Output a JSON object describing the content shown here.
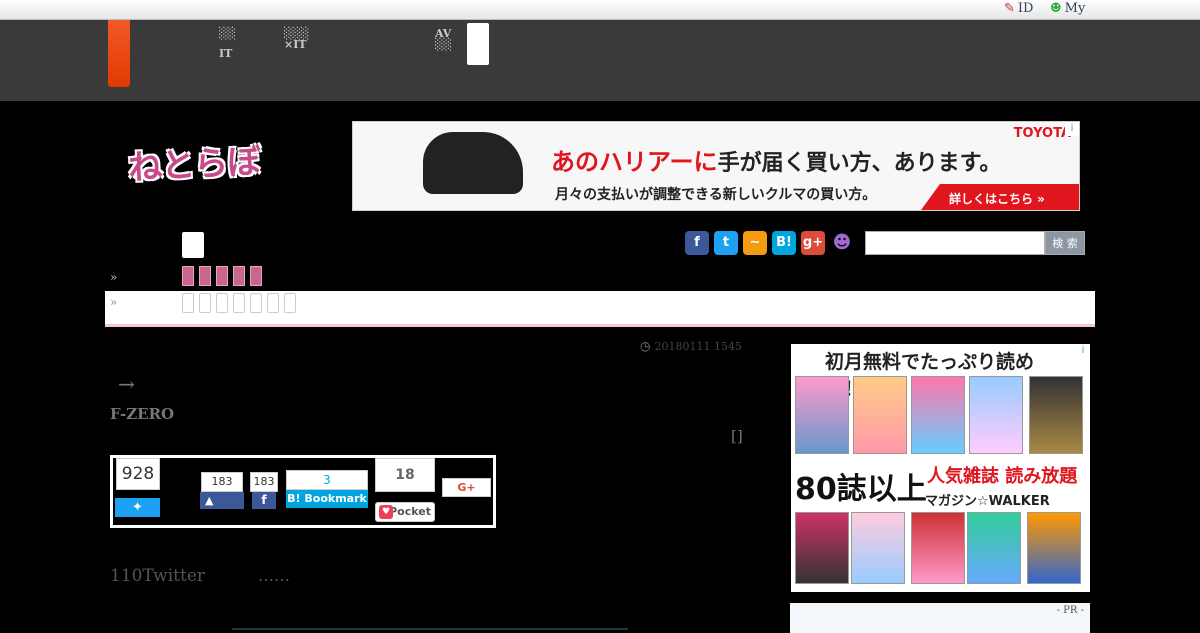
{
  "topbar": {
    "id_label": "ID",
    "my_label": "My"
  },
  "nav": {
    "item1_line1": "░░",
    "item1_line2": "IT",
    "item2_line1": "░░░",
    "item2_line2": "×IT",
    "item3_line1": "AV",
    "item3_line2": "░░"
  },
  "logo": "ねとらぼ",
  "banner": {
    "main_red": "あのハリアーに",
    "main_rest": "手が届く買い方、あります。",
    "sub": "月々の支払いが調整できる新しいクルマの買い方。",
    "cta": "詳しくはこちら »",
    "brand": "TOYOTA"
  },
  "search": {
    "button": "検 索",
    "placeholder": ""
  },
  "breadcrumb": {
    "raquo": "»"
  },
  "article": {
    "date": "20180111 1545",
    "arrow": "→",
    "title_fragment": "F-ZERO",
    "bracket": "[]",
    "lead": "110Twitter",
    "ellipsis": "……"
  },
  "shares": {
    "twitter_count": "928",
    "like_count": "183",
    "facebook_count": "183",
    "hatena_count": "3",
    "hatena_label": "B! Bookmark",
    "pocket_count": "18",
    "pocket_label": "Pocket",
    "gplus_label": "G+"
  },
  "sidebar_ad": {
    "title": "初月無料でたっぷり読める！！",
    "count_text": "80誌以上",
    "headline": "人気雑誌 読み放題",
    "service": "マガジン☆WALKER"
  },
  "pr_label": "- PR -",
  "colors": {
    "accent_orange": "#e84a1a",
    "pink": "#c8668f",
    "twitter": "#1da1f2",
    "facebook": "#3b5998",
    "hatena": "#00a4de",
    "pocket": "#ee4056",
    "gplus": "#dd4b39"
  }
}
